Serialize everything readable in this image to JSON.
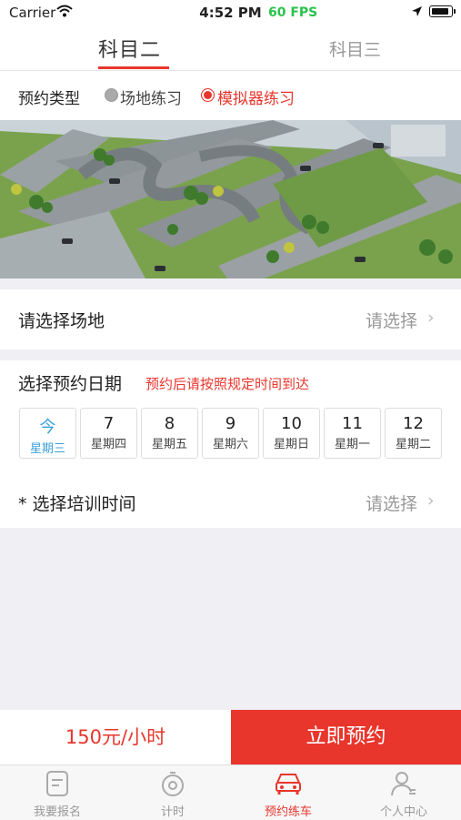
{
  "status_bar": {
    "carrier": "Carrier",
    "time": "4:52 PM",
    "fps": "60 FPS"
  },
  "tabs": [
    {
      "label": "科目二",
      "active": true
    },
    {
      "label": "科目三",
      "active": false
    }
  ],
  "type_row": {
    "label": "预约类型",
    "options": [
      {
        "label": "场地练习",
        "selected": false
      },
      {
        "label": "模拟器练习",
        "selected": true
      }
    ]
  },
  "site_row": {
    "label": "请选择场地",
    "value": "请选择"
  },
  "date_section": {
    "label": "选择预约日期",
    "note": "预约后请按照规定时间到达",
    "days": [
      {
        "day": "今",
        "weekday": "星期三",
        "selected": true
      },
      {
        "day": "7",
        "weekday": "星期四"
      },
      {
        "day": "8",
        "weekday": "星期五"
      },
      {
        "day": "9",
        "weekday": "星期六"
      },
      {
        "day": "10",
        "weekday": "星期日"
      },
      {
        "day": "11",
        "weekday": "星期一"
      },
      {
        "day": "12",
        "weekday": "星期二"
      }
    ]
  },
  "time_row": {
    "label": "* 选择培训时间",
    "value": "请选择"
  },
  "bottom": {
    "price": "150元/小时",
    "book": "立即预约"
  },
  "tabbar": [
    {
      "label": "我要报名",
      "icon": "form-icon"
    },
    {
      "label": "计时",
      "icon": "timer-icon"
    },
    {
      "label": "预约练车",
      "icon": "car-icon",
      "active": true
    },
    {
      "label": "个人中心",
      "icon": "person-icon"
    }
  ],
  "colors": {
    "accent": "#e8362d",
    "selected_date": "#3ba0d8",
    "fps": "#29c24b"
  }
}
